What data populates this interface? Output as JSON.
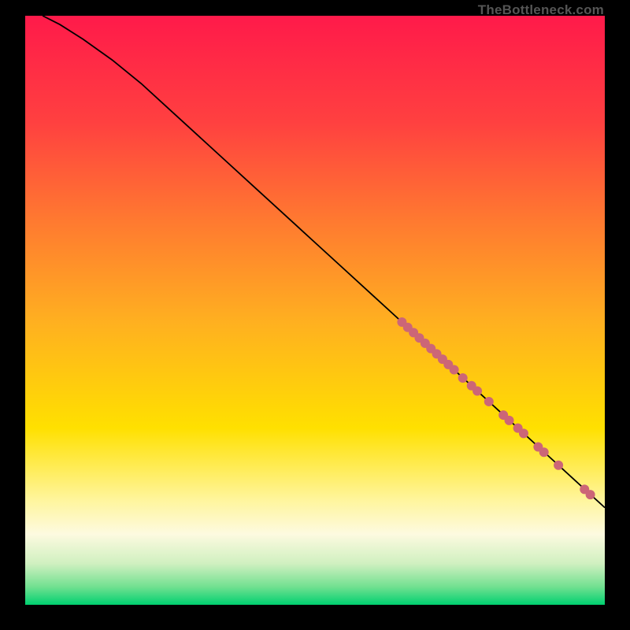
{
  "attribution": "TheBottleneck.com",
  "chart_data": {
    "type": "line",
    "title": "",
    "xlabel": "",
    "ylabel": "",
    "xlim": [
      0,
      100
    ],
    "ylim": [
      0,
      100
    ],
    "grid": false,
    "background_gradient": {
      "stops": [
        {
          "pos": 0.0,
          "color": "#ff1a4a"
        },
        {
          "pos": 0.18,
          "color": "#ff4040"
        },
        {
          "pos": 0.35,
          "color": "#ff7a30"
        },
        {
          "pos": 0.52,
          "color": "#ffb020"
        },
        {
          "pos": 0.7,
          "color": "#ffe000"
        },
        {
          "pos": 0.82,
          "color": "#fff59a"
        },
        {
          "pos": 0.88,
          "color": "#fdfae0"
        },
        {
          "pos": 0.93,
          "color": "#d0f0c0"
        },
        {
          "pos": 0.97,
          "color": "#70e090"
        },
        {
          "pos": 1.0,
          "color": "#00d070"
        }
      ]
    },
    "series": [
      {
        "name": "curve",
        "type": "line",
        "color": "#000000",
        "x": [
          3,
          6,
          10,
          15,
          20,
          25,
          30,
          35,
          40,
          45,
          50,
          55,
          60,
          65,
          70,
          75,
          80,
          85,
          90,
          95,
          100
        ],
        "y": [
          100,
          98.5,
          96,
          92.5,
          88.5,
          84,
          79.5,
          75,
          70.5,
          66,
          61.5,
          57,
          52.5,
          48,
          43.5,
          39,
          34.5,
          30,
          25.5,
          21,
          16.5
        ]
      },
      {
        "name": "scatter-points",
        "type": "scatter",
        "color": "#cc6677",
        "marker_radius": 6,
        "points": [
          {
            "x": 65,
            "y": 48.0
          },
          {
            "x": 66,
            "y": 47.1
          },
          {
            "x": 67,
            "y": 46.2
          },
          {
            "x": 68,
            "y": 45.3
          },
          {
            "x": 69,
            "y": 44.4
          },
          {
            "x": 70,
            "y": 43.5
          },
          {
            "x": 71,
            "y": 42.6
          },
          {
            "x": 72,
            "y": 41.7
          },
          {
            "x": 73,
            "y": 40.8
          },
          {
            "x": 74,
            "y": 39.9
          },
          {
            "x": 75.5,
            "y": 38.5
          },
          {
            "x": 77,
            "y": 37.2
          },
          {
            "x": 78,
            "y": 36.3
          },
          {
            "x": 80,
            "y": 34.5
          },
          {
            "x": 82.5,
            "y": 32.2
          },
          {
            "x": 83.5,
            "y": 31.3
          },
          {
            "x": 85,
            "y": 30.0
          },
          {
            "x": 86,
            "y": 29.1
          },
          {
            "x": 88.5,
            "y": 26.8
          },
          {
            "x": 89.5,
            "y": 25.9
          },
          {
            "x": 92,
            "y": 23.7
          },
          {
            "x": 96.5,
            "y": 19.6
          },
          {
            "x": 97.5,
            "y": 18.7
          }
        ]
      }
    ]
  }
}
